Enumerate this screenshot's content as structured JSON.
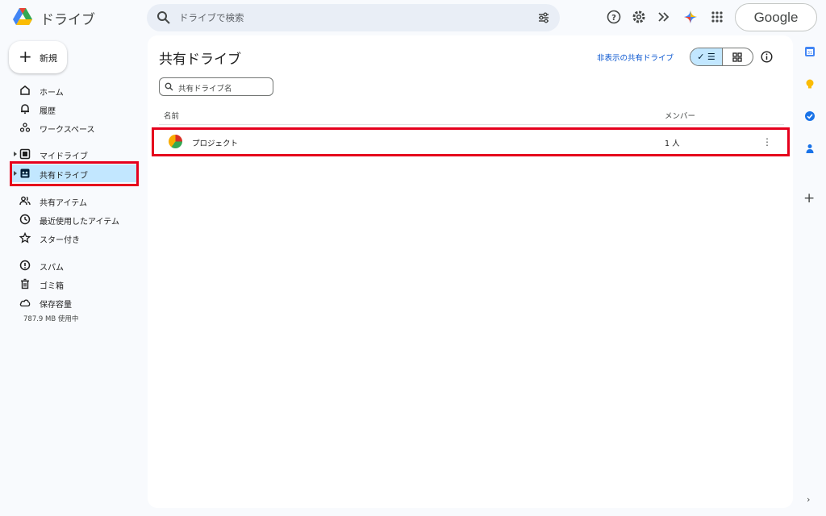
{
  "app": {
    "title": "ドライブ"
  },
  "search": {
    "placeholder": "ドライブで検索"
  },
  "topbar": {
    "icons": [
      "help-icon",
      "settings-icon",
      "gemini-forward-icon",
      "gemini-sparkle-icon",
      "apps-grid-icon"
    ],
    "account_label": "Google"
  },
  "sidebar": {
    "new_label": "新規",
    "items": [
      {
        "label": "ホーム",
        "icon": "home-icon"
      },
      {
        "label": "履歴",
        "icon": "bell-icon"
      },
      {
        "label": "ワークスペース",
        "icon": "workspace-icon"
      },
      {
        "label": "マイドライブ",
        "icon": "my-drive-icon"
      },
      {
        "label": "共有ドライブ",
        "icon": "shared-drive-icon",
        "active": true
      },
      {
        "label": "共有アイテム",
        "icon": "people-icon"
      },
      {
        "label": "最近使用したアイテム",
        "icon": "clock-icon"
      },
      {
        "label": "スター付き",
        "icon": "star-icon"
      },
      {
        "label": "スパム",
        "icon": "spam-icon"
      },
      {
        "label": "ゴミ箱",
        "icon": "trash-icon"
      },
      {
        "label": "保存容量",
        "icon": "cloud-icon"
      }
    ],
    "storage_used": "787.9 MB 使用中"
  },
  "main": {
    "title": "共有ドライブ",
    "hidden_link": "非表示の共有ドライブ",
    "view_toggle": {
      "list_label": "✓ ☰",
      "selected": "list"
    },
    "filter_placeholder": "共有ドライブ名",
    "columns": {
      "name": "名前",
      "members": "メンバー"
    },
    "rows": [
      {
        "name": "プロジェクト",
        "members": "1 人"
      }
    ]
  },
  "colors": {
    "accent": "#0b57d0",
    "active_bg": "#c2e7ff",
    "highlight": "#e5001c",
    "page_bg": "#f8fafd"
  }
}
